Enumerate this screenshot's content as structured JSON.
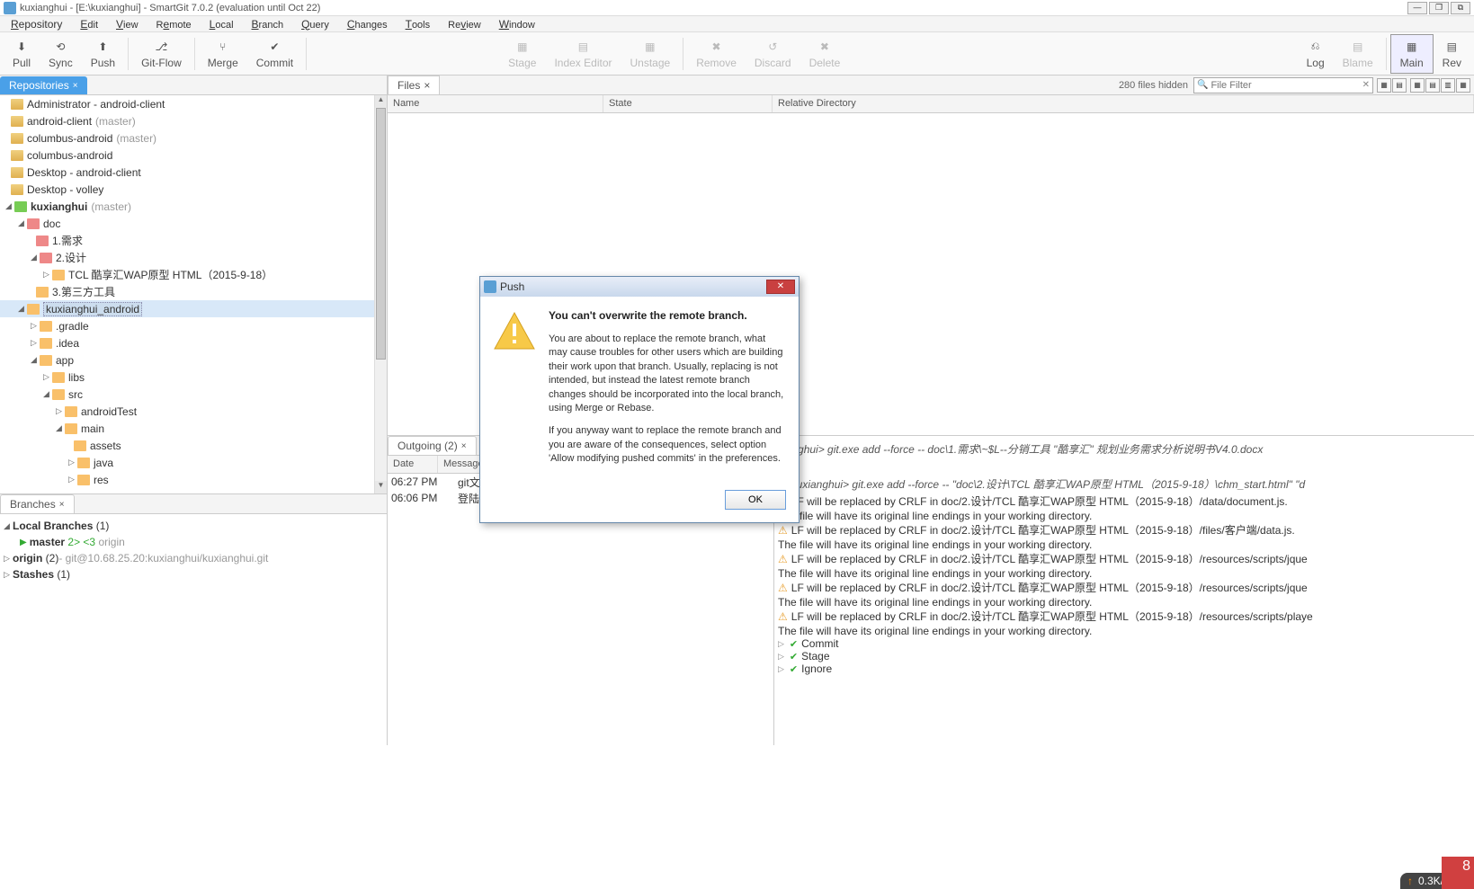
{
  "window": {
    "title": "kuxianghui - [E:\\kuxianghui] - SmartGit 7.0.2 (evaluation until Oct 22)"
  },
  "menus": [
    "Repository",
    "Edit",
    "View",
    "Remote",
    "Local",
    "Branch",
    "Query",
    "Changes",
    "Tools",
    "Review",
    "Window"
  ],
  "toolbar": {
    "pull": "Pull",
    "sync": "Sync",
    "push": "Push",
    "gitflow": "Git-Flow",
    "merge": "Merge",
    "commit": "Commit",
    "stage": "Stage",
    "indexeditor": "Index Editor",
    "unstage": "Unstage",
    "remove": "Remove",
    "discard": "Discard",
    "delete": "Delete",
    "log": "Log",
    "blame": "Blame",
    "main": "Main",
    "review": "Rev"
  },
  "repo_tab": "Repositories",
  "repos": [
    {
      "name": "Administrator - android-client",
      "branch": ""
    },
    {
      "name": "android-client",
      "branch": "(master)"
    },
    {
      "name": "columbus-android",
      "branch": "(master)"
    },
    {
      "name": "columbus-android",
      "branch": ""
    },
    {
      "name": "Desktop - android-client",
      "branch": ""
    },
    {
      "name": "Desktop - volley",
      "branch": ""
    }
  ],
  "kux": {
    "name": "kuxianghui",
    "branch": "(master)"
  },
  "tree": {
    "doc": "doc",
    "d1": "1.需求",
    "d2": "2.设计",
    "tcl": "TCL 酷享汇WAP原型 HTML（2015-9-18）",
    "d3": "3.第三方工具",
    "ka": "kuxianghui_android",
    "gradle": ".gradle",
    "idea": ".idea",
    "app": "app",
    "libs": "libs",
    "src": "src",
    "androidTest": "androidTest",
    "main": "main",
    "assets": "assets",
    "java": "java",
    "res": "res"
  },
  "branches_tab": "Branches",
  "branches": {
    "local": "Local Branches",
    "local_count": "(1)",
    "master": "master",
    "master_badge": "2> <3",
    "master_origin": "origin",
    "origin": "origin",
    "origin_count": "(2)",
    "origin_path": " - git@10.68.25.20:kuxianghui/kuxianghui.git",
    "stashes": "Stashes",
    "stashes_count": "(1)"
  },
  "files": {
    "tab": "Files",
    "hidden": "280 files hidden",
    "filter_ph": "File Filter",
    "col_name": "Name",
    "col_state": "State",
    "col_reldir": "Relative Directory"
  },
  "outgoing": {
    "tab": "Outgoing (2)",
    "col_date": "Date",
    "col_msg": "Message",
    "rows": [
      {
        "time": "06:27 PM",
        "msg": "git文件"
      },
      {
        "time": "06:06 PM",
        "msg": "登陆页面"
      }
    ]
  },
  "output": {
    "cmd1": "xianghui> git.exe add --force -- doc\\1.需求\\~$L--分销工具 \"酷享汇\" 规划业务需求分析说明书V4.0.docx",
    "cmd2": "E:\\kuxianghui> git.exe add --force -- \"doc\\2.设计\\TCL 酷享汇WAP原型 HTML（2015-9-18）\\chm_start.html\" \"d",
    "w1": "LF will be replaced by CRLF in doc/2.设计/TCL 酷享汇WAP原型 HTML（2015-9-18）/data/document.js.",
    "txt": "The file will have its original line endings in your working directory.",
    "w2": "LF will be replaced by CRLF in doc/2.设计/TCL 酷享汇WAP原型 HTML（2015-9-18）/files/客户端/data.js.",
    "w3": "LF will be replaced by CRLF in doc/2.设计/TCL 酷享汇WAP原型 HTML（2015-9-18）/resources/scripts/jque",
    "w4": "LF will be replaced by CRLF in doc/2.设计/TCL 酷享汇WAP原型 HTML（2015-9-18）/resources/scripts/jque",
    "w5": "LF will be replaced by CRLF in doc/2.设计/TCL 酷享汇WAP原型 HTML（2015-9-18）/resources/scripts/playe",
    "commit": "Commit",
    "stage": "Stage",
    "ignore": "Ignore"
  },
  "dialog": {
    "title": "Push",
    "heading": "You can't overwrite the remote branch.",
    "p1": "You are about to replace the remote branch, what may cause troubles for other users which are building their work upon that branch. Usually, replacing is not intended, but instead the latest remote branch changes should be incorporated into the local branch, using Merge or Rebase.",
    "p2": "If you anyway want to replace the remote branch and you are aware of the consequences, select option 'Allow modifying pushed commits' in the preferences.",
    "ok": "OK"
  },
  "status": {
    "speed": "0.3K/s"
  }
}
